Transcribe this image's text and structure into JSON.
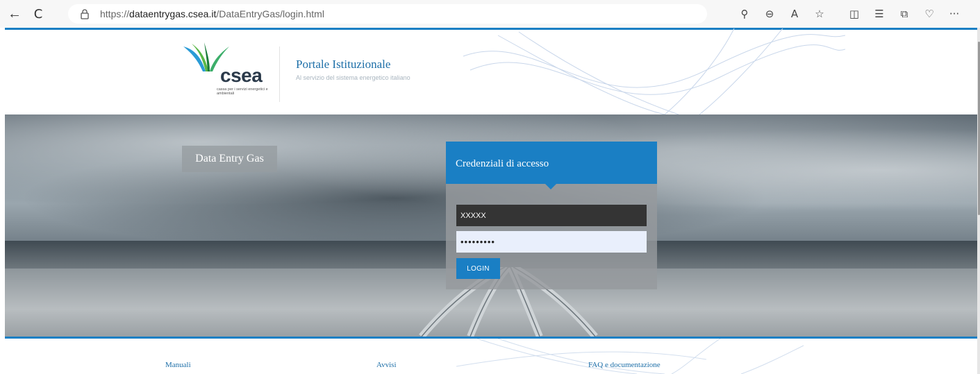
{
  "browser": {
    "url_prefix": "https://",
    "url_host": "dataentrygas.csea.it",
    "url_path": "/DataEntryGas/login.html",
    "back_glyph": "←",
    "refresh_glyph": "C",
    "toolbar_glyphs": [
      "⚲",
      "⊖",
      "A",
      "☆",
      "◫",
      "☰",
      "⧉",
      "♡",
      "···"
    ]
  },
  "header": {
    "logo_word": "csea",
    "logo_sub": "cassa per i servizi energetici e ambientali",
    "portal_title": "Portale Istituzionale",
    "portal_subtitle": "Al servizio del sistema energetico italiano"
  },
  "hero": {
    "app_label": "Data Entry Gas"
  },
  "login": {
    "title": "Credenziali di accesso",
    "username_value": "XXXXX",
    "password_value": "•••••••••",
    "button_label": "LOGIN"
  },
  "footer": {
    "links": [
      "Manuali",
      "Avvisi",
      "FAQ e documentazione"
    ]
  },
  "colors": {
    "accent": "#1a7fc4",
    "title_blue": "#1d6fa8"
  }
}
